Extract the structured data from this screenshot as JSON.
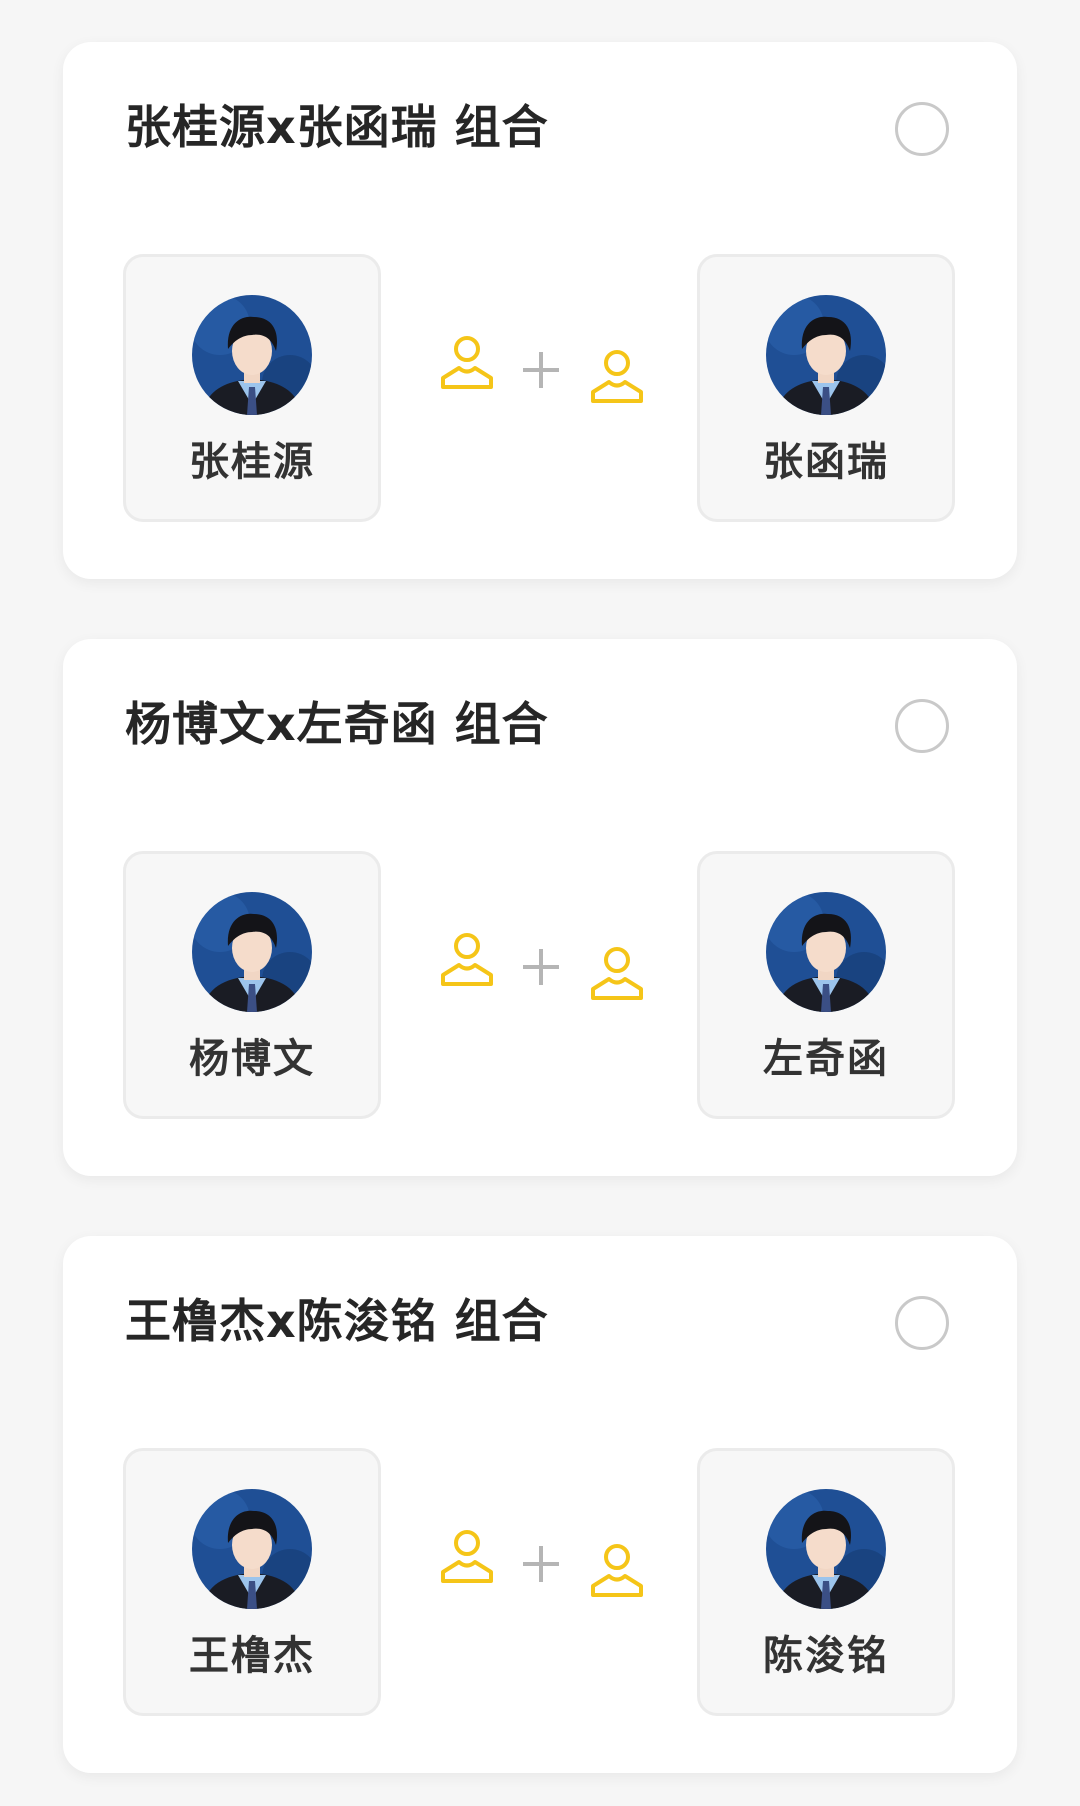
{
  "colors": {
    "accent": "#f5c518",
    "background": "#f6f6f6",
    "card": "#ffffff",
    "title_text": "#262626",
    "radio_border": "#c9c9c9",
    "plus": "#b5b5b5"
  },
  "icons": {
    "person_left": "person-outline-icon",
    "plus": "plus-icon",
    "person_right": "person-outline-icon",
    "selector": "radio-circle-icon"
  },
  "groups": [
    {
      "title": "张桂源x张函瑞 组合",
      "selected": false,
      "members": [
        {
          "name": "张桂源"
        },
        {
          "name": "张函瑞"
        }
      ]
    },
    {
      "title": "杨博文x左奇函 组合",
      "selected": false,
      "members": [
        {
          "name": "杨博文"
        },
        {
          "name": "左奇函"
        }
      ]
    },
    {
      "title": "王橹杰x陈浚铭 组合",
      "selected": false,
      "members": [
        {
          "name": "王橹杰"
        },
        {
          "name": "陈浚铭"
        }
      ]
    }
  ]
}
